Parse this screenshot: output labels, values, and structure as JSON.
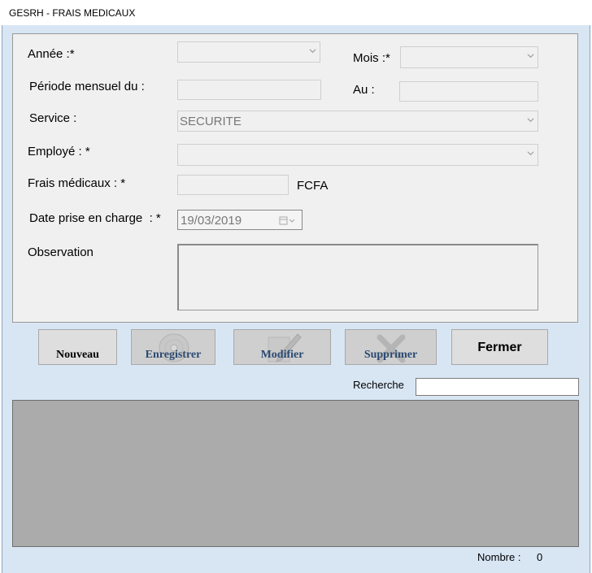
{
  "window": {
    "title": "GESRH - FRAIS MEDICAUX"
  },
  "form": {
    "annee_label": "Année :*",
    "annee_value": "",
    "mois_label": "Mois :*",
    "mois_value": "",
    "periode_label": "Période mensuel du :",
    "periode_value": "",
    "au_label": "Au :",
    "au_value": "",
    "service_label": "Service :",
    "service_value": "SECURITE",
    "employe_label": "Employé : *",
    "employe_value": "",
    "frais_label": "Frais médicaux : *",
    "frais_value": "",
    "currency": "FCFA",
    "date_label": "Date prise en charge  : *",
    "date_value": "19/03/2019",
    "observation_label": "Observation",
    "observation_value": ""
  },
  "buttons": {
    "nouveau": "Nouveau",
    "enregistrer": "Enregistrer",
    "modifier": "Modifier",
    "supprimer": "Supprimer",
    "fermer": "Fermer"
  },
  "search": {
    "label": "Recherche",
    "value": ""
  },
  "footer": {
    "count_label": "Nombre :",
    "count_value": "0"
  },
  "colors": {
    "form_background": "#d8e6f4",
    "grid_background": "#ababab",
    "panel_background": "#f0f0f0",
    "disabled_label": "#2b4a72"
  },
  "icons": {
    "enregistrer": "disc-icon",
    "modifier": "pencil-icon",
    "supprimer": "x-delete-icon",
    "combo_arrow": "chevron-down-icon",
    "date_picker": "calendar-icon"
  }
}
